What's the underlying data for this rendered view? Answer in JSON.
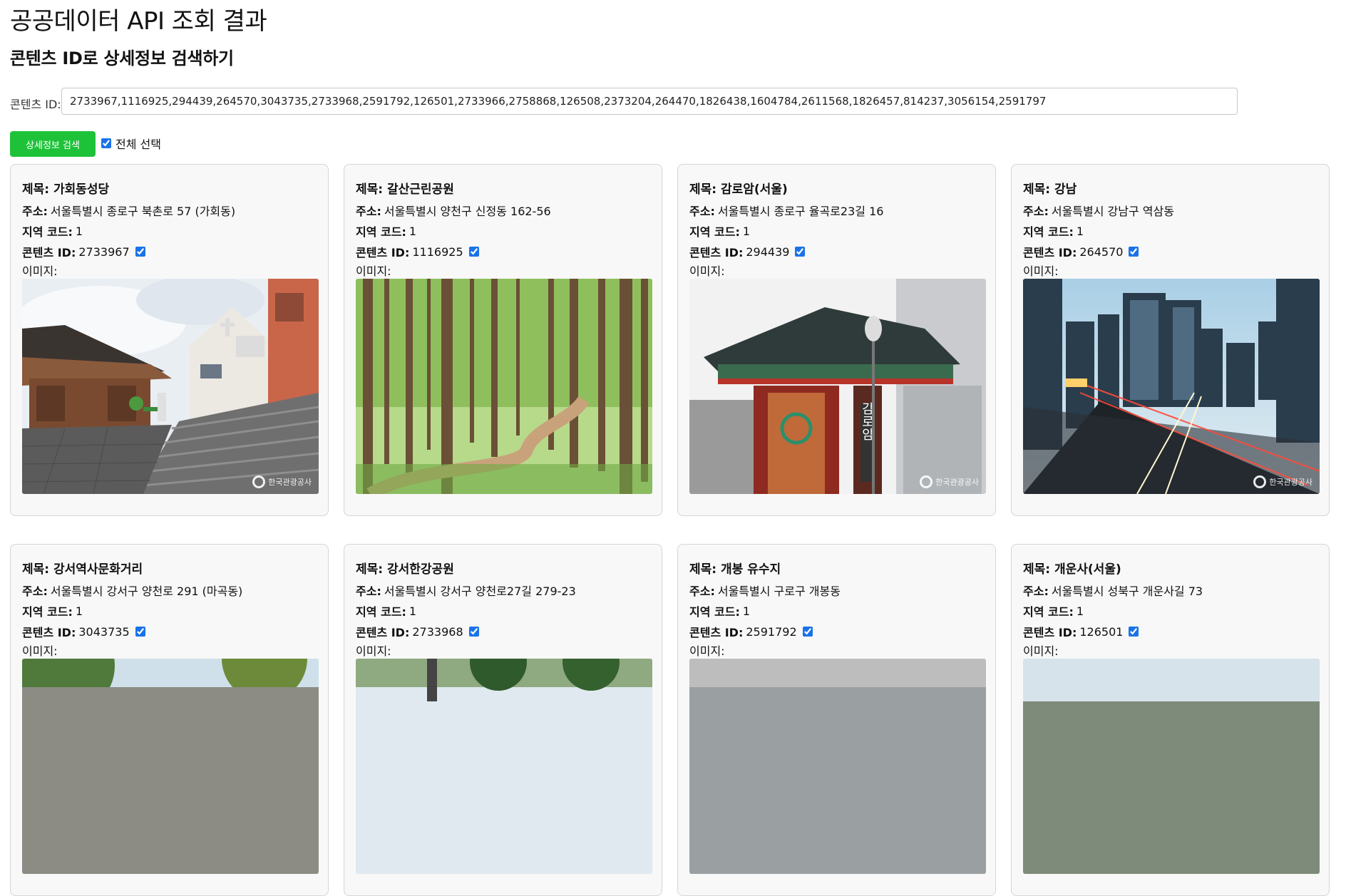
{
  "page": {
    "title": "공공데이터 API 조회 결과",
    "subtitle": "콘텐츠 ID로 상세정보 검색하기"
  },
  "search": {
    "label": "콘텐츠 ID:",
    "value": "2733967,1116925,294439,264570,3043735,2733968,2591792,126501,2733966,2758868,126508,2373204,264470,1826438,1604784,2611568,1826457,814237,3056154,2591797",
    "button_label": "상세정보 검색",
    "select_all_label": "전체 선택",
    "select_all_checked": true
  },
  "labels": {
    "title": "제목:",
    "address": "주소:",
    "area_code": "지역 코드:",
    "content_id": "콘텐츠 ID:",
    "image": "이미지:"
  },
  "cards": [
    {
      "title": "가회동성당",
      "address": "서울특별시 종로구 북촌로 57 (가회동)",
      "area_code": "1",
      "content_id": "2733967",
      "checked": true,
      "image": "church-hanok-photo",
      "watermark": "한국관광공사"
    },
    {
      "title": "갈산근린공원",
      "address": "서울특별시 양천구 신정동 162-56",
      "area_code": "1",
      "content_id": "1116925",
      "checked": true,
      "image": "forest-path-photo"
    },
    {
      "title": "감로암(서울)",
      "address": "서울특별시 종로구 율곡로23길 16",
      "area_code": "1",
      "content_id": "294439",
      "checked": true,
      "image": "temple-gate-photo",
      "watermark": "한국관광공사",
      "sign": "감로암"
    },
    {
      "title": "강남",
      "address": "서울특별시 강남구 역삼동",
      "area_code": "1",
      "content_id": "264570",
      "checked": true,
      "image": "gangnam-city-photo",
      "watermark": "한국관광공사"
    },
    {
      "title": "강서역사문화거리",
      "address": "서울특별시 강서구 양천로 291 (마곡동)",
      "area_code": "1",
      "content_id": "3043735",
      "checked": true,
      "image": "street-trees-photo"
    },
    {
      "title": "강서한강공원",
      "address": "서울특별시 강서구 양천로27길 279-23",
      "area_code": "1",
      "content_id": "2733968",
      "checked": true,
      "image": "park-trees-photo"
    },
    {
      "title": "개봉 유수지",
      "address": "서울특별시 구로구 개봉동",
      "area_code": "1",
      "content_id": "2591792",
      "checked": true,
      "image": "grey-sky-photo"
    },
    {
      "title": "개운사(서울)",
      "address": "서울특별시 성북구 개운사길 73",
      "area_code": "1",
      "content_id": "126501",
      "checked": true,
      "image": "temple-sky-photo"
    }
  ]
}
